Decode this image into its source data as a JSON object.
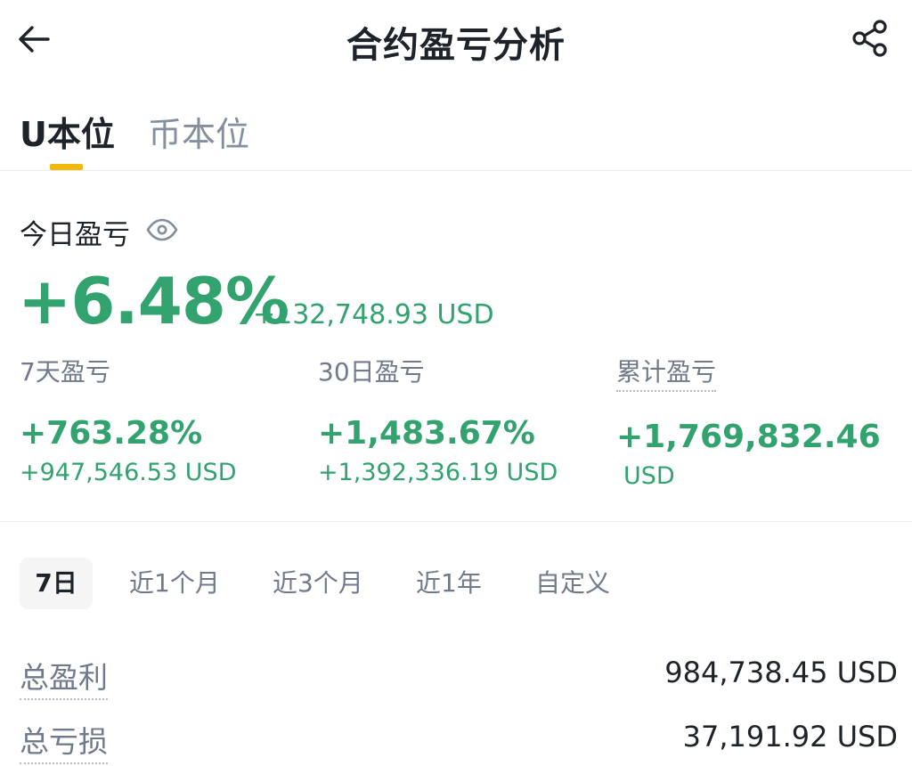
{
  "header": {
    "title": "合约盈亏分析",
    "back_icon": "arrow-left-icon",
    "share_icon": "share-icon"
  },
  "tabs": [
    {
      "label": "U本位",
      "active": true
    },
    {
      "label": "币本位",
      "active": false
    }
  ],
  "today": {
    "label": "今日盈亏",
    "icon": "eye-icon",
    "percent": "+6.48%",
    "amount": "+132,748.93 USD"
  },
  "stats": [
    {
      "label": "7天盈亏",
      "percent": "+763.28%",
      "amount": "+947,546.53 USD"
    },
    {
      "label": "30日盈亏",
      "percent": "+1,483.67%",
      "amount": "+1,392,336.19 USD"
    },
    {
      "label": "累计盈亏",
      "percent": "+1,769,832.46",
      "amount": "USD"
    }
  ],
  "periods": [
    {
      "label": "7日",
      "active": true
    },
    {
      "label": "近1个月",
      "active": false
    },
    {
      "label": "近3个月",
      "active": false
    },
    {
      "label": "近1年",
      "active": false
    },
    {
      "label": "自定义",
      "active": false
    }
  ],
  "summary": [
    {
      "label": "总盈利",
      "value": "984,738.45 USD"
    },
    {
      "label": "总亏损",
      "value": "37,191.92 USD"
    }
  ],
  "colors": {
    "positive": "#32a36f",
    "accent": "#f0b90b",
    "text_primary": "#1e2329",
    "text_secondary": "#707a8a"
  }
}
